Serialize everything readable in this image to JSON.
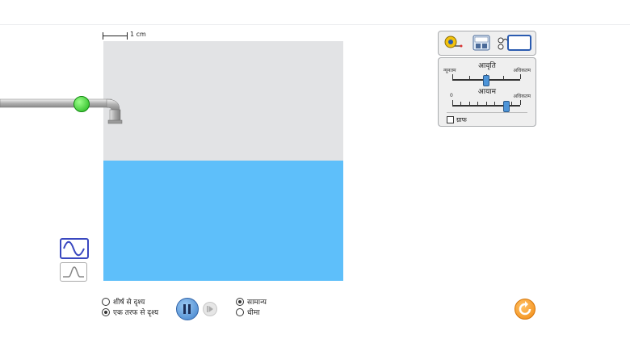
{
  "scale": {
    "label": "1 cm"
  },
  "controls": {
    "frequency": {
      "title": "आवृति",
      "min_label": "न्यूनतम",
      "max_label": "अधिकतम",
      "value_fraction": 0.5
    },
    "amplitude": {
      "title": "आयाम",
      "min_label": "0",
      "max_label": "अधिकतम",
      "value_fraction": 0.8
    },
    "graph_label": "ग्राफ",
    "graph_checked": false
  },
  "view_options": {
    "top_view_label": "शीर्ष से दृश्य",
    "side_view_label": "एक तरफ से दृश्य",
    "selected": "side"
  },
  "speed_options": {
    "normal_label": "सामान्य",
    "slow_label": "धीमा",
    "selected": "normal"
  },
  "colors": {
    "water": "#5ebffa",
    "tank": "#e2e3e5",
    "accent": "#3a48c0",
    "reset": "#f28a12"
  },
  "icons": {
    "wave_selected": "sine-wave-icon",
    "wave_unselected": "pulse-wave-icon"
  }
}
